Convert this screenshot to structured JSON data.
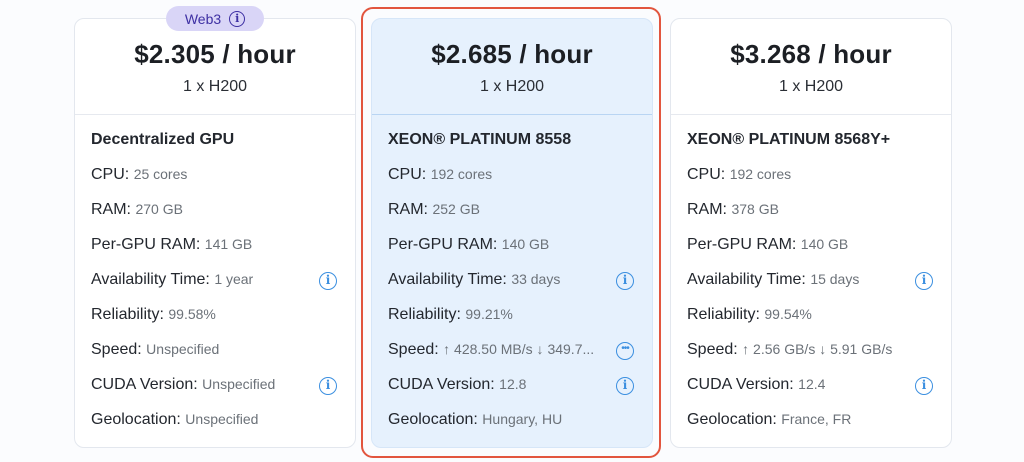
{
  "badge": {
    "label": "Web3",
    "icon": "info-icon"
  },
  "cards": [
    {
      "price": "$2.305 / hour",
      "gpu": "1 x H200",
      "cpu_name": "Decentralized GPU",
      "cpu": {
        "label": "CPU:",
        "value": "25 cores"
      },
      "ram": {
        "label": "RAM:",
        "value": "270 GB"
      },
      "gpu_ram": {
        "label": "Per-GPU RAM:",
        "value": "141 GB"
      },
      "availability": {
        "label": "Availability Time:",
        "value": "1 year"
      },
      "reliability": {
        "label": "Reliability:",
        "value": "99.58%"
      },
      "speed": {
        "label": "Speed:",
        "value": "Unspecified"
      },
      "cuda": {
        "label": "CUDA Version:",
        "value": "Unspecified"
      },
      "geo": {
        "label": "Geolocation:",
        "value": "Unspecified"
      }
    },
    {
      "price": "$2.685 / hour",
      "gpu": "1 x H200",
      "cpu_name": "XEON® PLATINUM 8558",
      "cpu": {
        "label": "CPU:",
        "value": "192 cores"
      },
      "ram": {
        "label": "RAM:",
        "value": "252 GB"
      },
      "gpu_ram": {
        "label": "Per-GPU RAM:",
        "value": "140 GB"
      },
      "availability": {
        "label": "Availability Time:",
        "value": "33 days"
      },
      "reliability": {
        "label": "Reliability:",
        "value": "99.21%"
      },
      "speed": {
        "label": "Speed:",
        "value": "↑ 428.50 MB/s ↓ 349.7..."
      },
      "cuda": {
        "label": "CUDA Version:",
        "value": "12.8"
      },
      "geo": {
        "label": "Geolocation:",
        "value": "Hungary, HU"
      }
    },
    {
      "price": "$3.268 / hour",
      "gpu": "1 x H200",
      "cpu_name": "XEON® PLATINUM 8568Y+",
      "cpu": {
        "label": "CPU:",
        "value": "192 cores"
      },
      "ram": {
        "label": "RAM:",
        "value": "378 GB"
      },
      "gpu_ram": {
        "label": "Per-GPU RAM:",
        "value": "140 GB"
      },
      "availability": {
        "label": "Availability Time:",
        "value": "15 days"
      },
      "reliability": {
        "label": "Reliability:",
        "value": "99.54%"
      },
      "speed": {
        "label": "Speed:",
        "value": "↑ 2.56 GB/s ↓ 5.91 GB/s"
      },
      "cuda": {
        "label": "CUDA Version:",
        "value": "12.4"
      },
      "geo": {
        "label": "Geolocation:",
        "value": "France, FR"
      }
    }
  ],
  "colors": {
    "accent": "#3b8fe0",
    "selected_border": "#e2553e",
    "selected_bg": "#e6f1fd",
    "badge_bg": "#d9d5f7",
    "badge_text": "#3d2fa3"
  }
}
